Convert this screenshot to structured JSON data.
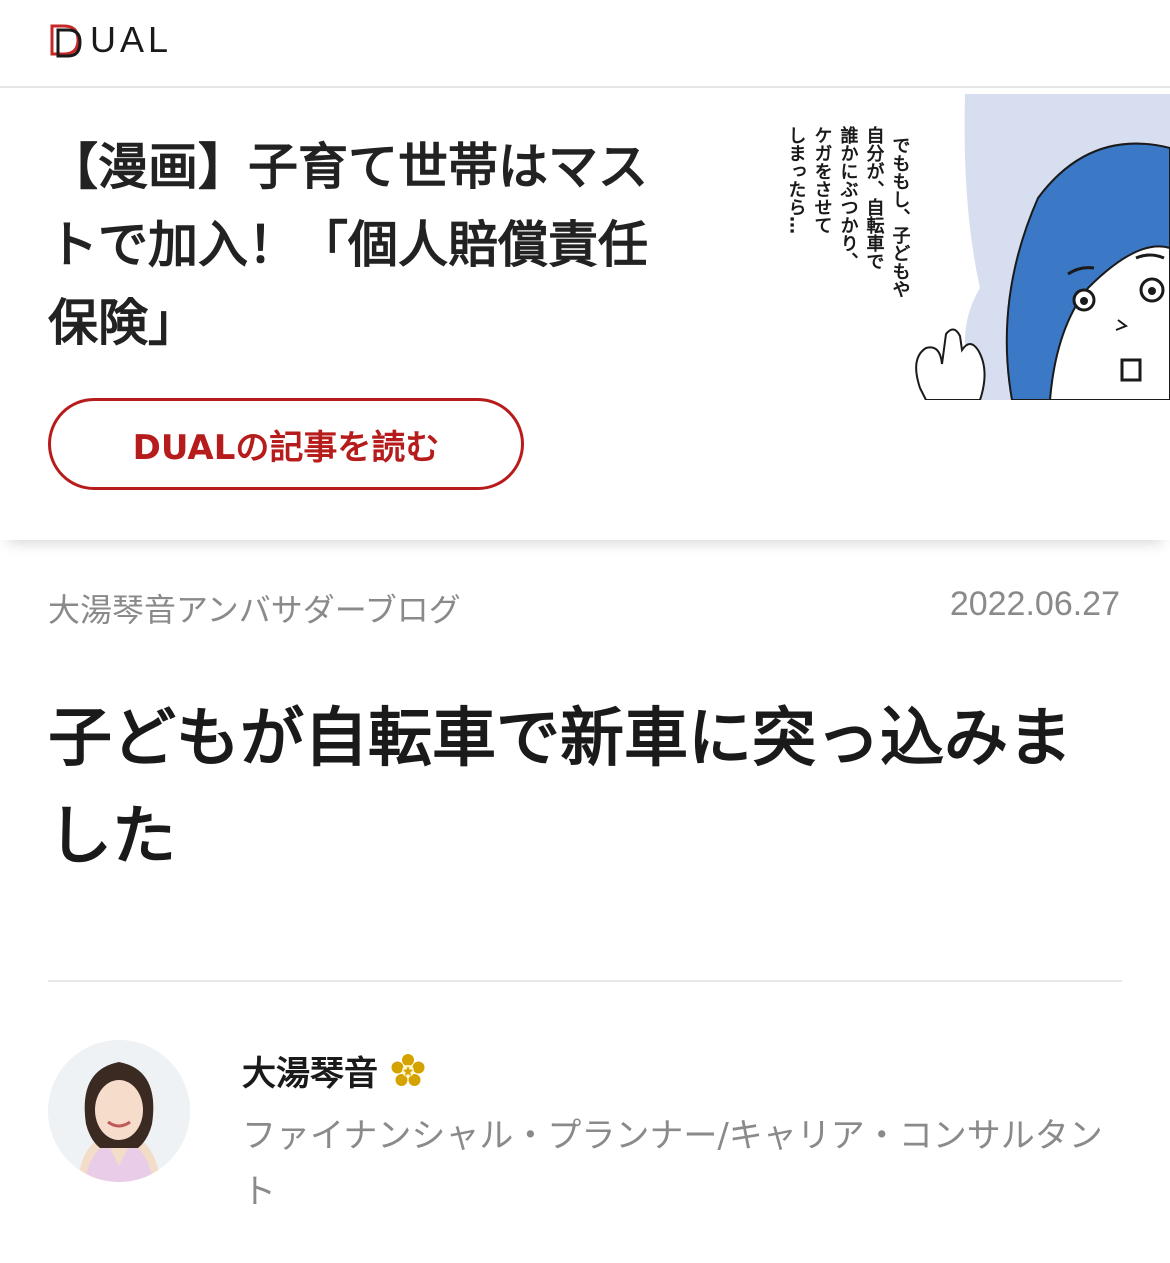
{
  "header": {
    "logo_text": "UAL",
    "logo_full": "DUAL"
  },
  "promo": {
    "title": "【漫画】子育て世帯はマストで加入！「個人賠償責任保険」",
    "button_label": "DUALの記事を読む",
    "manga_text": [
      "でももし、子どもや",
      "自分が、自転車で",
      "誰かにぶつかり、",
      "ケガをさせて",
      "しまったら…"
    ]
  },
  "article": {
    "blog_name": "大湯琴音アンバサダーブログ",
    "date": "2022.06.27",
    "title": "子どもが自転車で新車に突っ込みました"
  },
  "author": {
    "name": "大湯琴音",
    "role": "ファイナンシャル・プランナー/キャリア・コンサルタント"
  },
  "colors": {
    "accent": "#b71c1c",
    "muted_text": "#8a8a8a",
    "manga_blue": "#3b78c6",
    "badge_gold": "#d4a300"
  }
}
